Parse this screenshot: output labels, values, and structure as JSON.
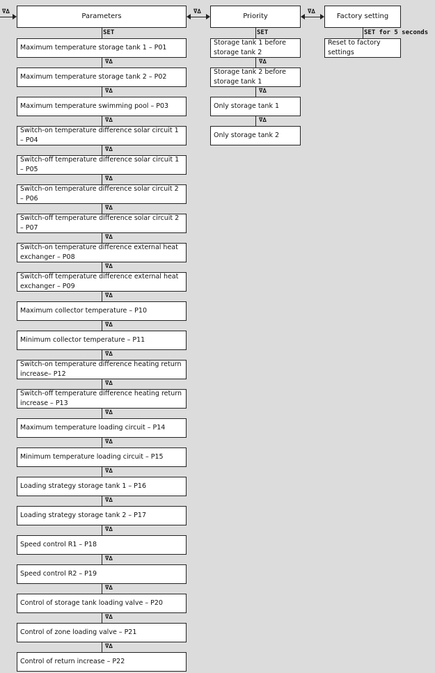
{
  "nav_symbol": "∇∆",
  "set_label": "SET",
  "columns": {
    "parameters": {
      "title": "Parameters",
      "items": [
        "Maximum temperature storage tank 1 – P01",
        "Maximum temperature storage tank 2 – P02",
        "Maximum temperature swimming pool – P03",
        "Switch-on temperature difference solar circuit 1 – P04",
        "Switch-off temperature difference solar circuit 1 – P05",
        "Switch-on temperature difference solar circuit 2 – P06",
        "Switch-off temperature difference solar circuit 2 – P07",
        "Switch-on temperature difference external heat exchanger – P08",
        "Switch-off temperature difference external heat exchanger – P09",
        "Maximum collector temperature – P10",
        "Minimum collector temperature – P11",
        "Switch-on temperature difference heating return increase– P12",
        "Switch-off temperature difference heating return increase – P13",
        "Maximum temperature loading circuit – P14",
        "Minimum temperature loading circuit – P15",
        "Loading strategy storage tank 1 – P16",
        "Loading strategy storage tank 2 – P17",
        "Speed control R1 – P18",
        "Speed control R2 – P19",
        "Control of storage tank loading valve – P20",
        "Control of zone loading valve – P21",
        "Control of return increase – P22"
      ]
    },
    "priority": {
      "title": "Priority",
      "items": [
        "Storage tank 1 before storage tank 2",
        "Storage tank 2 before storage tank 1",
        "Only storage tank 1",
        "Only storage tank 2"
      ]
    },
    "factory": {
      "title": "Factory setting",
      "set_label": "SET for 5 seconds",
      "items": [
        "Reset to factory settings"
      ]
    }
  }
}
